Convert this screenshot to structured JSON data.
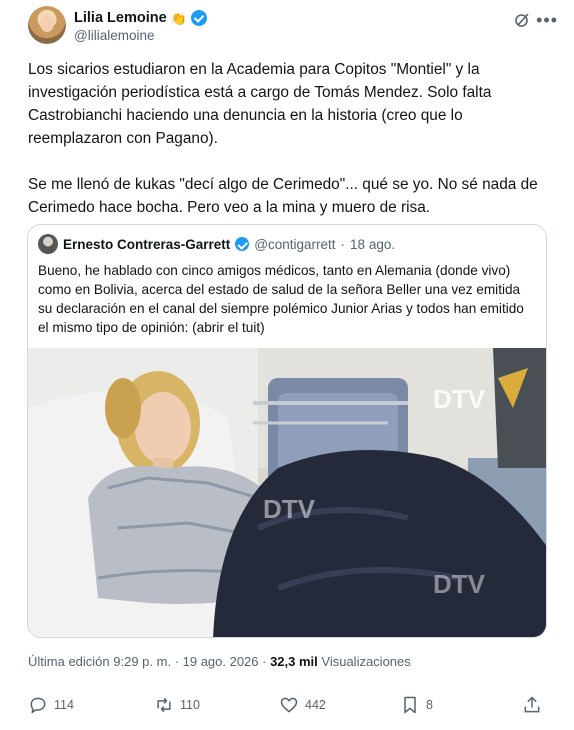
{
  "author": {
    "display_name": "Lilia Lemoine",
    "emoji": "👏",
    "handle": "@lilialemoine"
  },
  "tweet": {
    "paragraph1": "Los sicarios estudiaron en la Academia para Copitos \"Montiel\" y la investigación periodística está a cargo de Tomás Mendez. Solo falta Castrobianchi haciendo una  denuncia  en la historia (creo que lo reemplazaron con Pagano).",
    "paragraph2": "Se me llenó de kukas \"decí algo de Cerimedo\"... qué se yo. No sé nada de Cerimedo hace bocha. Pero veo a la mina y muero de risa."
  },
  "quoted": {
    "display_name": "Ernesto Contreras-Garrett",
    "handle": "@contigarrett",
    "separator": "·",
    "date": "18 ago.",
    "text": "Bueno, he hablado con cinco amigos médicos, tanto en Alemania (donde vivo) como en Bolivia, acerca del estado de salud de la señora Beller una vez emitida su declaración en el canal del siempre polémico Junior Arias y todos han emitido el mismo tipo de opinión: (abrir el tuit)",
    "image_watermarks": [
      "DTV",
      "DTV",
      "DTV"
    ]
  },
  "meta": {
    "edited_prefix": "Última edición 9:29 p. m. · 19 ago. 2026 · ",
    "views_count": "32,3 mil",
    "views_label": " Visualizaciones"
  },
  "actions": {
    "replies": "114",
    "reposts": "110",
    "likes": "442",
    "bookmarks": "8"
  },
  "icons": [
    "grok-icon",
    "more-icon",
    "verified-icon",
    "reply-icon",
    "repost-icon",
    "like-icon",
    "bookmark-icon",
    "share-icon"
  ],
  "colors": {
    "verified": "#1d9bf0",
    "secondary_text": "#536471",
    "primary_text": "#0f1419",
    "border": "#cfd9de"
  }
}
